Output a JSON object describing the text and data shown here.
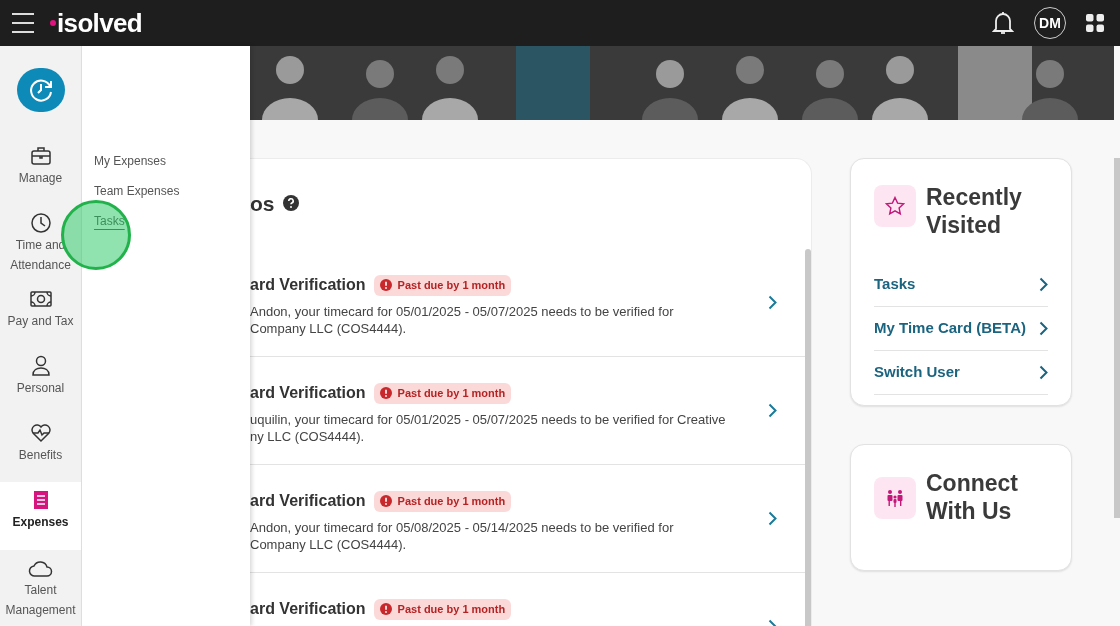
{
  "top_bar": {
    "logo": "isolved",
    "avatar": "DM"
  },
  "rail": {
    "items": [
      {
        "kind": "clock",
        "selected": false
      },
      {
        "kind": "briefcase",
        "label": "Manage",
        "selected": false
      },
      {
        "kind": "time",
        "label": "Time and Attendance",
        "selected": false
      },
      {
        "kind": "money",
        "label": "Pay and Tax",
        "selected": false
      },
      {
        "kind": "person",
        "label": "Personal",
        "selected": false
      },
      {
        "kind": "heart",
        "label": "Benefits",
        "selected": false
      },
      {
        "kind": "receipt",
        "label": "Expenses",
        "selected": true
      },
      {
        "kind": "cloud",
        "label": "Talent Management",
        "selected": false
      }
    ]
  },
  "flyout": {
    "items": [
      {
        "label": "My Expenses",
        "selected": false
      },
      {
        "label": "Team Expenses",
        "selected": false
      },
      {
        "label": "Tasks",
        "selected": true
      }
    ]
  },
  "tasks_card": {
    "title": "os",
    "rows": [
      {
        "title": "ard Verification",
        "badge": "Past due by 1 month",
        "description_lines": [
          "Andon, your timecard for 05/01/2025 - 05/07/2025 needs to be verified for",
          "Company LLC (COS4444)."
        ]
      },
      {
        "title": "ard Verification",
        "badge": "Past due by 1 month",
        "description_lines": [
          "uquilin, your timecard for 05/01/2025 - 05/07/2025 needs to be verified for Creative",
          "ny LLC (COS4444)."
        ]
      },
      {
        "title": "ard Verification",
        "badge": "Past due by 1 month",
        "description_lines": [
          "Andon, your timecard for 05/08/2025 - 05/14/2025 needs to be verified for",
          "Company LLC (COS4444)."
        ]
      },
      {
        "title": "ard Verification",
        "badge": "Past due by 1 month",
        "description_lines": []
      }
    ]
  },
  "recently_visited": {
    "title": "Recently Visited",
    "links": [
      "Tasks",
      "My Time Card (BETA)",
      "Switch User"
    ]
  },
  "connect": {
    "title": "Connect With Us"
  }
}
